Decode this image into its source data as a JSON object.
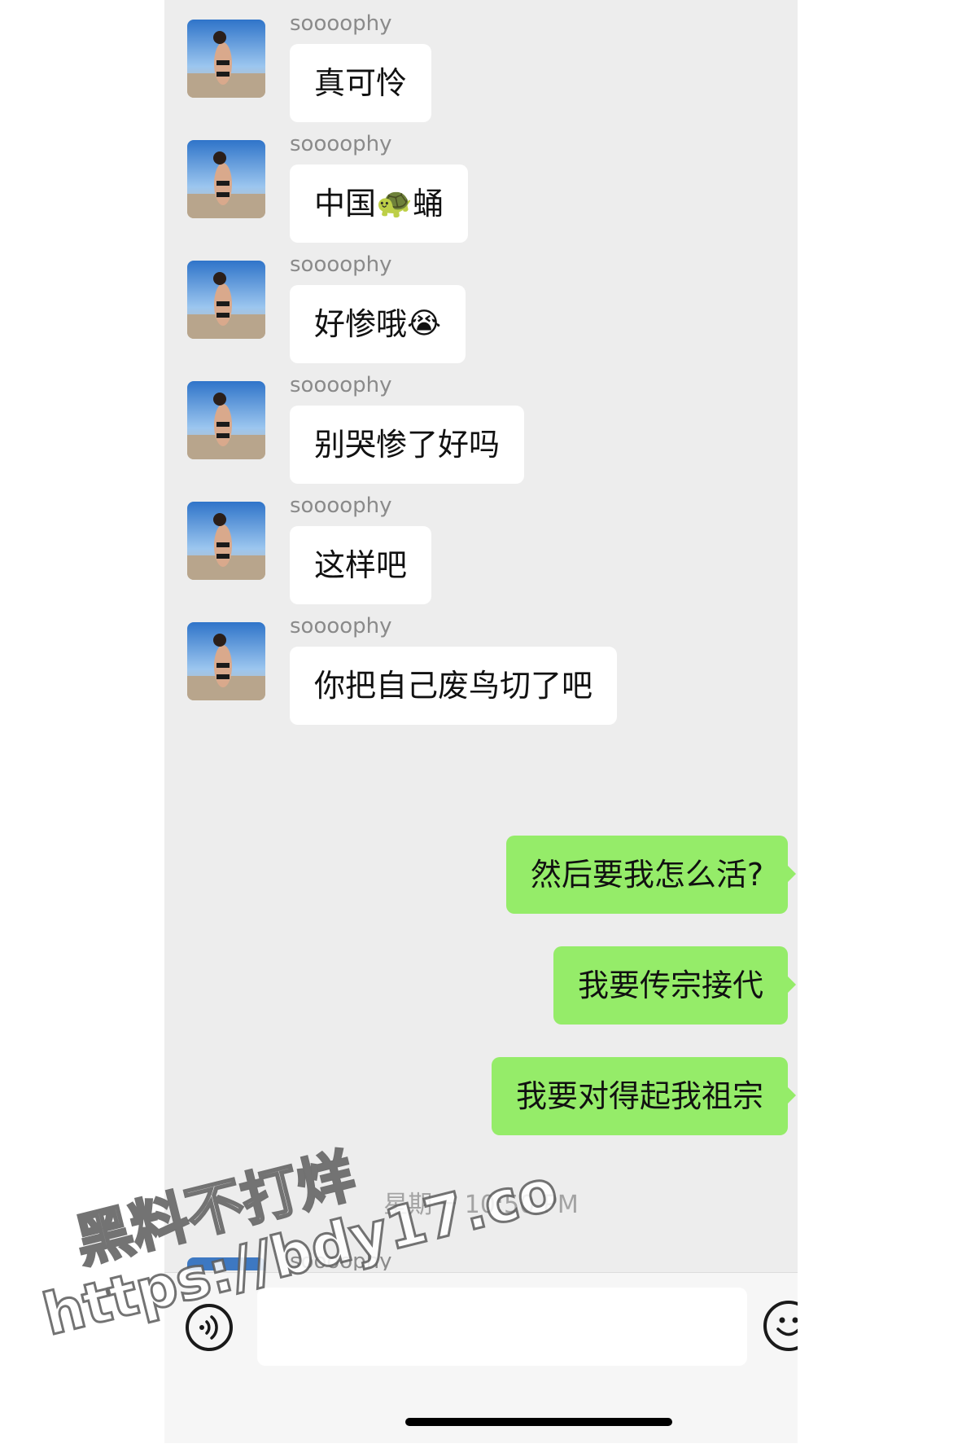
{
  "chat": {
    "sender": "soooophy",
    "incoming": [
      {
        "text": "真可怜"
      },
      {
        "text": "中国",
        "emoji": "🐢",
        "text_after": "蛹"
      },
      {
        "text": "好惨哦",
        "emoji": "😭"
      },
      {
        "text": "别哭惨了好吗"
      },
      {
        "text": "这样吧"
      },
      {
        "text": "你把自己废鸟切了吧"
      }
    ],
    "outgoing": [
      {
        "text": "然后要我怎么活?"
      },
      {
        "text": "我要传宗接代"
      },
      {
        "text": "我要对得起我祖宗"
      }
    ],
    "timestamp": "星期一 10:50 PM",
    "partial_sender": "soooophy"
  },
  "input_bar": {
    "voice_icon": "voice-icon",
    "emoji_icon": "smiley-icon"
  },
  "watermark": {
    "line1": "黑料不打烊",
    "line2": "https://bdy17.co"
  },
  "colors": {
    "background": "#ededed",
    "incoming_bubble": "#ffffff",
    "outgoing_bubble": "#95ec69",
    "name_gray": "#8a8a8a"
  }
}
